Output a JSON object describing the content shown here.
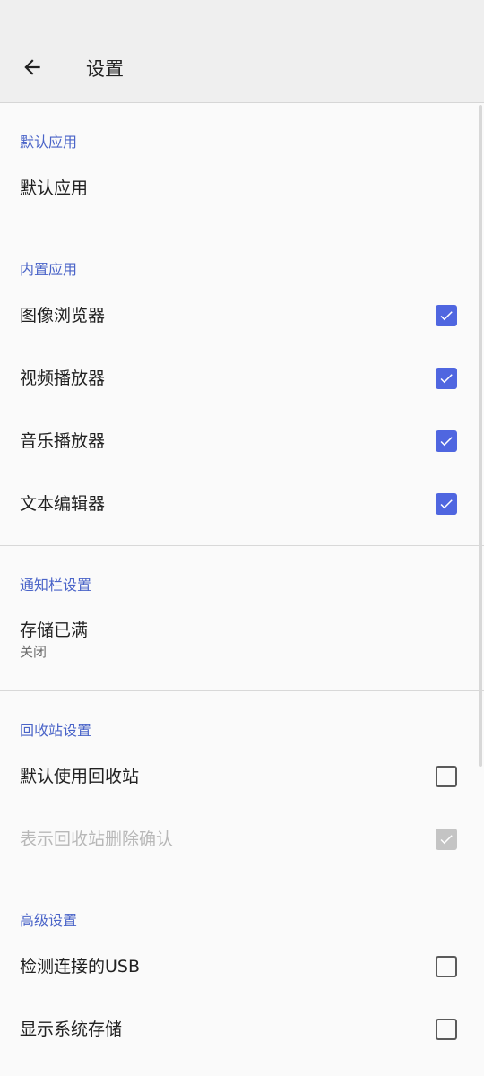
{
  "toolbar": {
    "title": "设置",
    "back_icon": "arrow-back-icon"
  },
  "sections": [
    {
      "header": "默认应用",
      "items": [
        {
          "label": "默认应用"
        }
      ]
    },
    {
      "header": "内置应用",
      "items": [
        {
          "label": "图像浏览器",
          "checked": true
        },
        {
          "label": "视频播放器",
          "checked": true
        },
        {
          "label": "音乐播放器",
          "checked": true
        },
        {
          "label": "文本编辑器",
          "checked": true
        }
      ]
    },
    {
      "header": "通知栏设置",
      "items": [
        {
          "label": "存储已满",
          "summary": "关闭"
        }
      ]
    },
    {
      "header": "回收站设置",
      "items": [
        {
          "label": "默认使用回收站",
          "checked": false
        },
        {
          "label": "表示回收站删除确认",
          "checked": true,
          "disabled": true
        }
      ]
    },
    {
      "header": "高级设置",
      "items": [
        {
          "label": "检测连接的USB",
          "checked": false
        },
        {
          "label": "显示系统存储",
          "checked": false
        }
      ]
    }
  ],
  "colors": {
    "accent": "#4f66e0",
    "header_text": "#4a64c8",
    "disabled_check": "#c4c4c4"
  }
}
